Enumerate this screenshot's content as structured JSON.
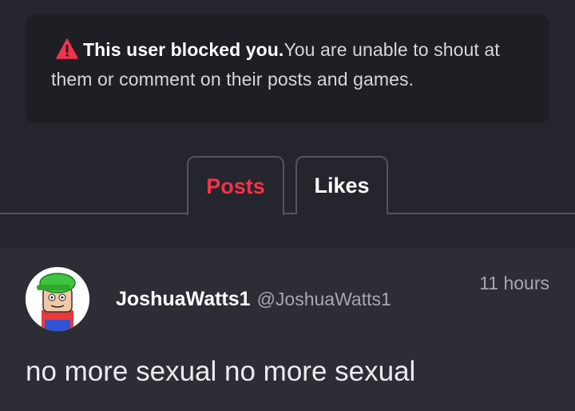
{
  "notice": {
    "bold_text": "This user blocked you.",
    "text": "You are unable to shout at them or comment on their posts and games.",
    "icon": "warning-triangle-icon",
    "accent": "#f2334a"
  },
  "tabs": [
    {
      "label": "Posts",
      "active": true
    },
    {
      "label": "Likes",
      "active": false
    }
  ],
  "post": {
    "username": "JoshuaWatts1",
    "handle": "@JoshuaWatts1",
    "time": "11 hours",
    "content": "no more sexual no more sexual"
  }
}
